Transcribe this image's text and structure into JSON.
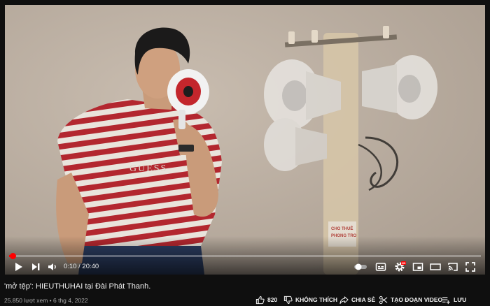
{
  "player": {
    "current_time": "0:10",
    "duration": "20:40",
    "progress": 0.008,
    "time_display": "0:10 / 20:40",
    "accent_color": "#ff0000",
    "controls": [
      "play-icon",
      "next-icon",
      "volume-icon",
      "autoplay-toggle",
      "subtitles-icon",
      "settings-icon",
      "miniplayer-icon",
      "theater-icon",
      "cast-icon",
      "fullscreen-icon"
    ],
    "settings_badge": "HD"
  },
  "video": {
    "title": "'mở tệp': HIEUTHUHAI tại Đài Phát Thanh.",
    "views": "25.850 lượt xem",
    "date": "6 thg 4, 2022",
    "meta_line": "25.850 lượt xem • 6 thg 4, 2022",
    "shirt_print": "GUESS",
    "sign_text": [
      "CHO THUÊ",
      "PHONG TRO"
    ]
  },
  "actions": {
    "like_count": "820",
    "dislike_label": "KHÔNG THÍCH",
    "share_label": "CHIA SẺ",
    "clip_label": "TẠO ĐOẠN VIDEO",
    "save_label": "LƯU"
  }
}
